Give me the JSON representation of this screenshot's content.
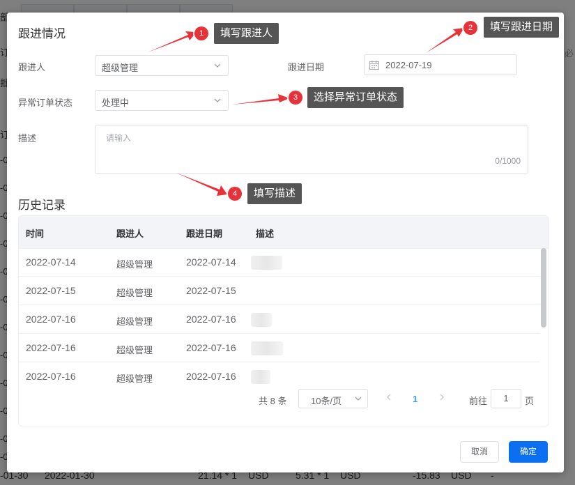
{
  "background": {
    "left_cells": [
      "部",
      "订",
      "批",
      "订",
      "-0",
      "-0",
      "-0",
      "-0",
      "-0",
      "-0",
      "-0",
      "-0",
      "-0",
      "-0",
      "-0",
      "-0"
    ],
    "right_cell": "必",
    "bottom_row": {
      "date1": "-01-30",
      "date2": "2022-01-30",
      "amount1": "21.14 * 1",
      "currency1": "USD",
      "amount2": "5.31 * 1",
      "currency2": "USD",
      "total": "-15.83",
      "currency3": "USD",
      "dash": "-"
    }
  },
  "dialog": {
    "title": "跟进情况",
    "form": {
      "follower_label": "跟进人",
      "follower_value": "超级管理",
      "date_label": "跟进日期",
      "date_value": "2022-07-19",
      "status_label": "异常订单状态",
      "status_value": "处理中",
      "desc_label": "描述",
      "desc_placeholder": "请输入",
      "desc_counter": "0/1000"
    },
    "history": {
      "title": "历史记录",
      "columns": [
        "时间",
        "跟进人",
        "跟进日期",
        "描述"
      ],
      "rows": [
        {
          "time": "2022-07-14",
          "person": "超级管理",
          "date": "2022-07-14"
        },
        {
          "time": "2022-07-15",
          "person": "超级管理",
          "date": "2022-07-15"
        },
        {
          "time": "2022-07-16",
          "person": "超级管理",
          "date": "2022-07-16"
        },
        {
          "time": "2022-07-16",
          "person": "超级管理",
          "date": "2022-07-16"
        },
        {
          "time": "2022-07-16",
          "person": "超级管理",
          "date": "2022-07-16"
        }
      ]
    },
    "pagination": {
      "total": "共 8 条",
      "page_size": "10条/页",
      "current_page": "1",
      "goto_label": "前往",
      "goto_value": "1",
      "page_suffix": "页"
    },
    "buttons": {
      "cancel": "取消",
      "confirm": "确定"
    }
  },
  "annotations": [
    {
      "number": "1",
      "text": "填写跟进人"
    },
    {
      "number": "2",
      "text": "填写跟进日期"
    },
    {
      "number": "3",
      "text": "选择异常订单状态"
    },
    {
      "number": "4",
      "text": "填写描述"
    }
  ],
  "colors": {
    "primary": "#0a6ff0",
    "annotation_badge": "#e8323a",
    "annotation_arrow": "#e8323a",
    "tooltip_bg": "#555555"
  }
}
